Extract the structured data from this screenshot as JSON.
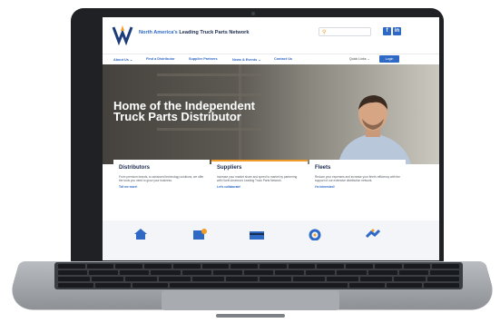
{
  "header": {
    "tagline_accent": "North America's",
    "tagline_rest": " Leading Truck Parts Network",
    "search_placeholder": "",
    "social": [
      "f",
      "in"
    ]
  },
  "nav": {
    "items": [
      "About Us ⌄",
      "Find a Distributor",
      "Supplier Partners",
      "News & Events ⌄",
      "Contact Us"
    ],
    "quick_links": "Quick Links ⌄",
    "login": "Login"
  },
  "hero": {
    "title": "Home of the Independent Truck Parts Distributor"
  },
  "cards": [
    {
      "title": "Distributors",
      "body": "From premium brands, to advanced technology solutions, we offer the tools you need to grow your business.",
      "link": "Tell me more!"
    },
    {
      "title": "Suppliers",
      "body": "Increase your market share and speed to market by partnering with North America's Leading Truck Parts Network.",
      "link": "Let's collaborate!"
    },
    {
      "title": "Fleets",
      "body": "Reduce your expenses and increase your fleet's efficiency with the support of our extensive distribution network.",
      "link": "I'm interested!"
    }
  ],
  "icon_strip": [
    "home-icon",
    "chart-icon",
    "card-icon",
    "gear-icon",
    "handshake-icon"
  ],
  "colors": {
    "brand_blue": "#2f69c6",
    "accent_orange": "#f29b26",
    "navy": "#1a2b50"
  }
}
